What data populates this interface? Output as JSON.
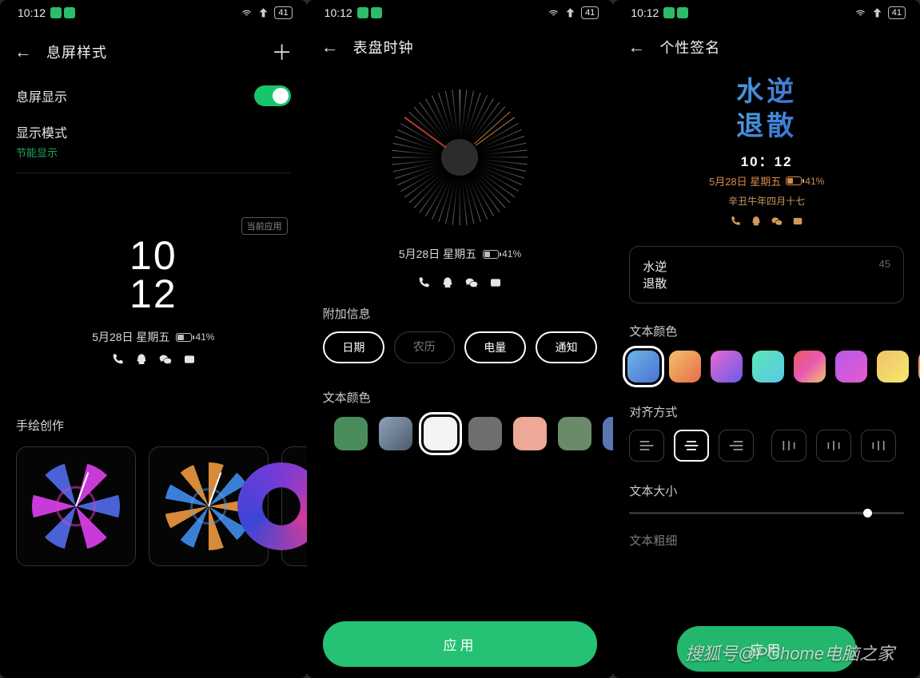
{
  "statusbar": {
    "time": "10:12",
    "battery": "41"
  },
  "screen1": {
    "title": "息屏样式",
    "aod_toggle_label": "息屏显示",
    "display_mode_label": "显示模式",
    "display_mode_value": "节能显示",
    "current_tag": "当前应用",
    "preview": {
      "hour": "10",
      "minute": "12",
      "date": "5月28日 星期五",
      "battery": "41%"
    },
    "section_drawing": "手绘创作"
  },
  "screen2": {
    "title": "表盘时钟",
    "preview": {
      "date": "5月28日 星期五",
      "battery": "41%"
    },
    "extra_label": "附加信息",
    "pills": [
      "日期",
      "农历",
      "电量",
      "通知"
    ],
    "pill_states": [
      "active",
      "dim",
      "active",
      "active"
    ],
    "color_label": "文本颜色",
    "colors": [
      "#4a8c5c",
      "linear-gradient(135deg,#8fa2b8,#4c5c6c)",
      "#f4f4f4",
      "#6e6e6e",
      "#eda898",
      "#6a8a6a",
      "#5a76b0"
    ],
    "selected_color_index": 2,
    "apply": "应用"
  },
  "screen3": {
    "title": "个性签名",
    "signature_line1": "水逆",
    "signature_line2": "退散",
    "time": "10：12",
    "date": "5月28日 星期五",
    "battery": "41%",
    "lunar": "辛丑牛年四月十七",
    "textarea_value": "水逆\n退散",
    "textarea_remaining": "45",
    "color_label": "文本颜色",
    "gradients": [
      "linear-gradient(135deg,#6fb4e8,#4a72d0)",
      "linear-gradient(135deg,#f2c36a,#e86a4a)",
      "linear-gradient(135deg,#e86ad0,#6a5ae8)",
      "linear-gradient(135deg,#5ae8b4,#5ac8e8)",
      "linear-gradient(135deg,#e85a5a,#e85ab4,#f2c36a)",
      "linear-gradient(135deg,#b45ae8,#e85ad0)",
      "linear-gradient(135deg,#f2c36a,#f2e86a)",
      "linear-gradient(135deg,#f28a5a,#f2c36a)"
    ],
    "selected_gradient_index": 0,
    "align_label": "对齐方式",
    "selected_align_index": 1,
    "size_label": "文本大小",
    "weight_label": "文本粗细",
    "apply": "应用"
  },
  "watermark": "搜狐号@PChome电脑之家"
}
